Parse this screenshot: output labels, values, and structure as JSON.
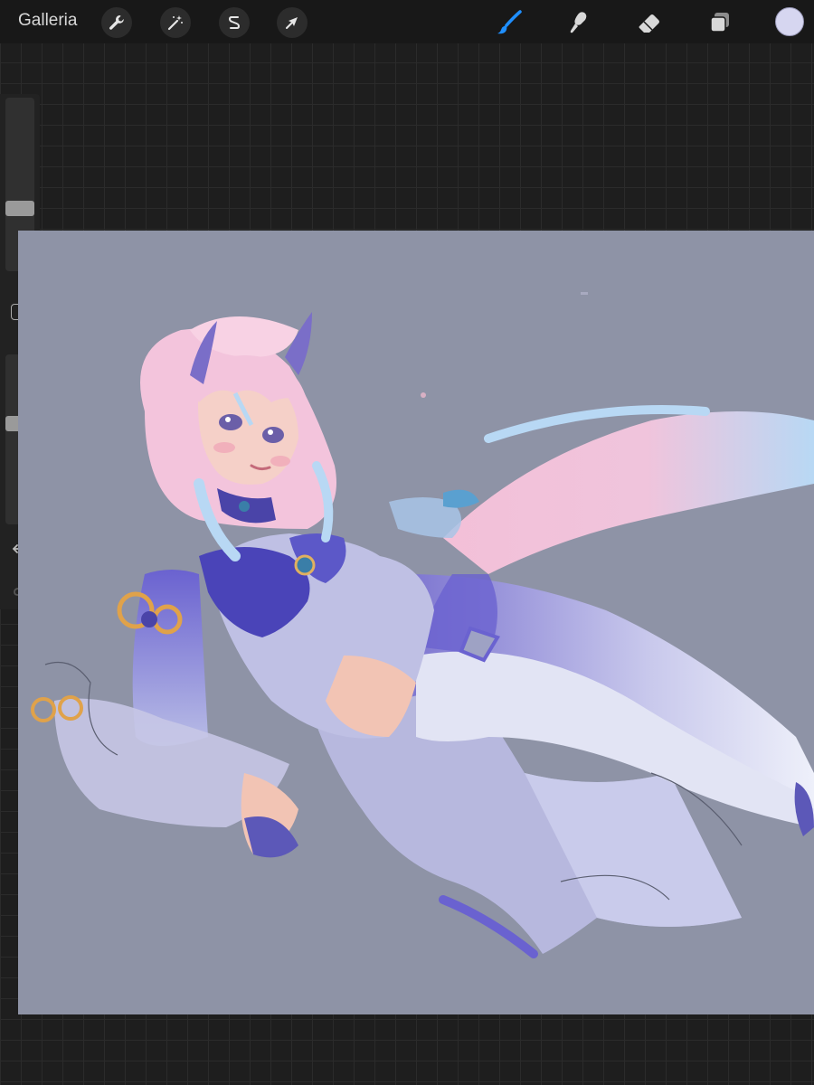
{
  "topbar": {
    "gallery_label": "Galleria",
    "left_tools": [
      {
        "name": "actions",
        "icon": "wrench-icon"
      },
      {
        "name": "adjustments",
        "icon": "magic-wand-icon"
      },
      {
        "name": "selection",
        "icon": "selection-s-icon"
      },
      {
        "name": "transform",
        "icon": "arrow-cursor-icon"
      }
    ],
    "right_tools": [
      {
        "name": "brush",
        "icon": "brush-icon",
        "active": true
      },
      {
        "name": "smudge",
        "icon": "smudge-icon",
        "active": false
      },
      {
        "name": "eraser",
        "icon": "eraser-icon",
        "active": false
      },
      {
        "name": "layers",
        "icon": "layers-icon",
        "active": false
      }
    ],
    "current_color": "#d6d6f0",
    "active_tool_color": "#1f8fff"
  },
  "sidebar": {
    "brush_size_level": 0.35,
    "opacity_level": 0.6,
    "icons": [
      "modify-square-icon",
      "undo-icon",
      "redo-icon"
    ]
  },
  "canvas": {
    "background_color": "#8e93a6",
    "artwork": "illustration-artwork"
  }
}
